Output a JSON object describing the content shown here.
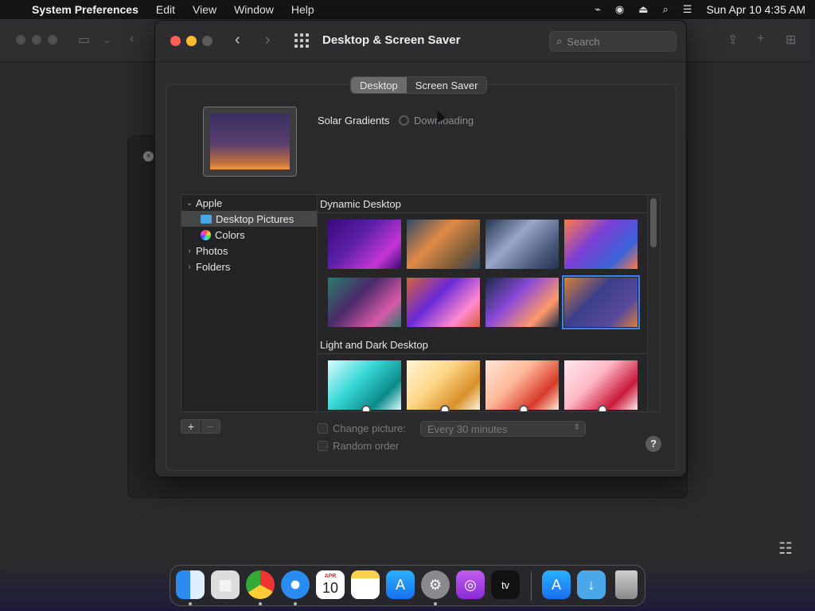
{
  "menubar": {
    "app": "System Preferences",
    "items": [
      "Edit",
      "View",
      "Window",
      "Help"
    ],
    "clock": "Sun Apr 10  4:35 AM"
  },
  "window": {
    "title": "Desktop & Screen Saver",
    "search_placeholder": "Search"
  },
  "tabs": [
    {
      "label": "Desktop",
      "active": true
    },
    {
      "label": "Screen Saver",
      "active": false
    }
  ],
  "wallpaper": {
    "name": "Solar Gradients",
    "status": "Downloading"
  },
  "sidebar": {
    "groups": [
      {
        "label": "Apple",
        "expanded": true,
        "children": [
          {
            "label": "Desktop Pictures",
            "selected": true,
            "icon": "folder-icon"
          },
          {
            "label": "Colors",
            "selected": false,
            "icon": "colors-icon"
          }
        ]
      },
      {
        "label": "Photos",
        "expanded": false
      },
      {
        "label": "Folders",
        "expanded": false
      }
    ]
  },
  "gallery": {
    "sections": [
      {
        "title": "Dynamic Desktop",
        "thumbnails": [
          {
            "name": "monterey-purple",
            "colors": [
              "#5b1fa8",
              "#c535d6",
              "#3a0a7a"
            ]
          },
          {
            "name": "catalina-island-day",
            "colors": [
              "#e08b46",
              "#7a5a3a",
              "#2d4966"
            ]
          },
          {
            "name": "catalina-island-dusk",
            "colors": [
              "#9aa6c8",
              "#4a5a7a",
              "#243550"
            ]
          },
          {
            "name": "big-sur-coast",
            "colors": [
              "#7a3fd6",
              "#3a63d8",
              "#ff7a4a"
            ]
          },
          {
            "name": "big-sur-graphic",
            "colors": [
              "#4a2a6a",
              "#d65aa8",
              "#2a7a6a"
            ]
          },
          {
            "name": "big-sur-mountains",
            "colors": [
              "#6a2ad8",
              "#ff8ad0",
              "#d8603a"
            ]
          },
          {
            "name": "big-sur-road",
            "colors": [
              "#8a4ad8",
              "#ff9a6a",
              "#1a2a4a"
            ]
          },
          {
            "name": "solar-gradients",
            "colors": [
              "#3a3f8a",
              "#5a4a9a",
              "#d8803a"
            ],
            "selected": true
          }
        ]
      },
      {
        "title": "Light and Dark Desktop",
        "thumbnails": [
          {
            "name": "teal-curves",
            "colors": [
              "#3ad8d8",
              "#0a8a8a",
              "#dafcff"
            ]
          },
          {
            "name": "gold-curves",
            "colors": [
              "#ffd88a",
              "#d8902a",
              "#fff4d8"
            ]
          },
          {
            "name": "coral-curves",
            "colors": [
              "#ffb89a",
              "#d83a2a",
              "#ffe8d8"
            ]
          },
          {
            "name": "pink-curves",
            "colors": [
              "#ffb8c8",
              "#c81a3a",
              "#ffe8ee"
            ]
          }
        ]
      }
    ]
  },
  "options": {
    "change_picture_label": "Change picture:",
    "interval": "Every 30 minutes",
    "random_order_label": "Random order",
    "help_label": "?"
  },
  "dock": {
    "apps": [
      "finder-icon",
      "launchpad-icon",
      "chrome-icon",
      "safari-icon",
      "calendar-icon",
      "notes-icon",
      "app-store-icon",
      "system-preferences-icon",
      "podcasts-icon",
      "apple-tv-icon",
      "app-store-downloads-icon",
      "downloads-folder-icon",
      "trash-icon"
    ],
    "calendar_month": "APR",
    "calendar_day": "10",
    "tv_label": "tv"
  }
}
